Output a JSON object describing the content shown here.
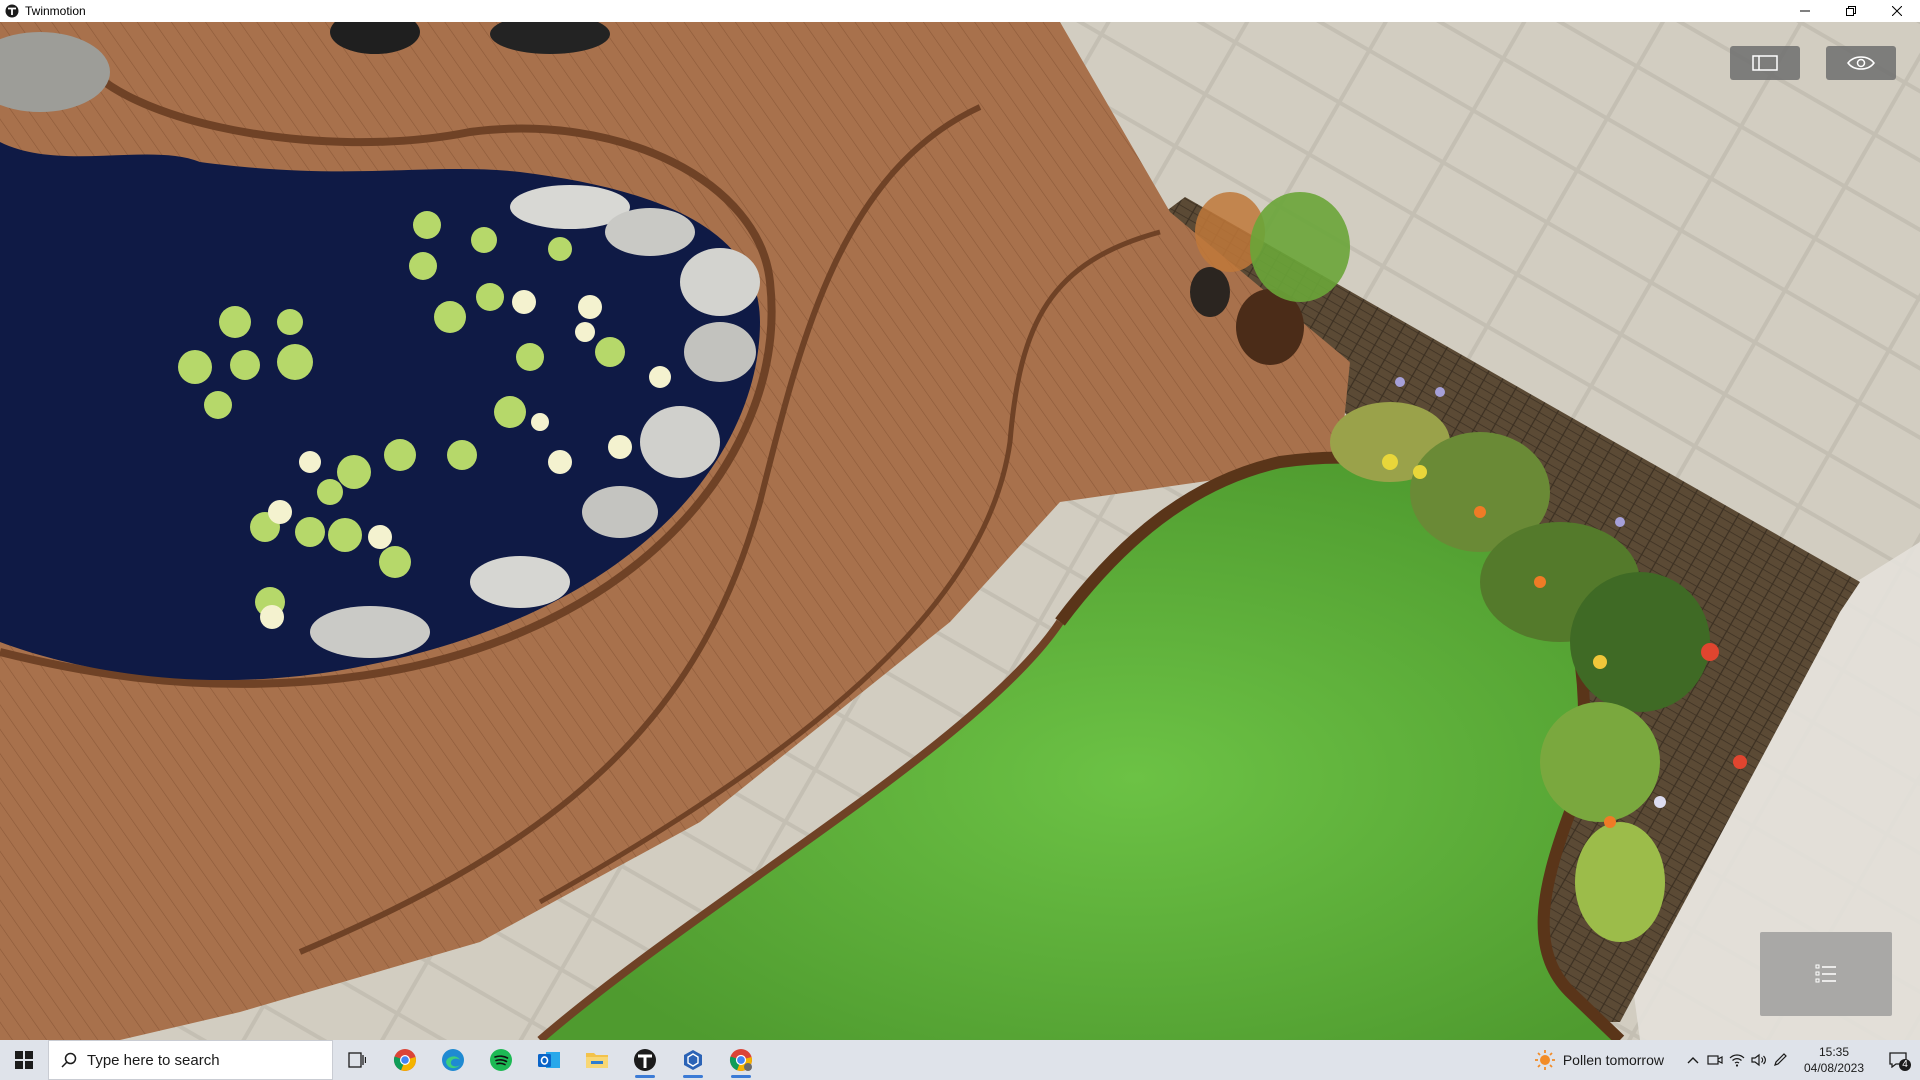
{
  "window": {
    "title": "Twinmotion"
  },
  "taskbar": {
    "search_placeholder": "Type here to search",
    "weather_text": "Pollen tomorrow",
    "clock_time": "15:35",
    "clock_date": "04/08/2023",
    "notification_count": "4",
    "pinned_apps": [
      "task-view",
      "chrome",
      "edge",
      "spotify",
      "outlook",
      "file-explorer",
      "twinmotion",
      "sketchup",
      "chrome-profile"
    ]
  },
  "colors": {
    "deck": "#a8714c",
    "deck_edge": "#7a4b2d",
    "pond": "#0f1a45",
    "lawn": "#5fb33a",
    "paving": "#d8d4c9",
    "brick": "#54432f",
    "lily_pad": "#b6d86a"
  }
}
